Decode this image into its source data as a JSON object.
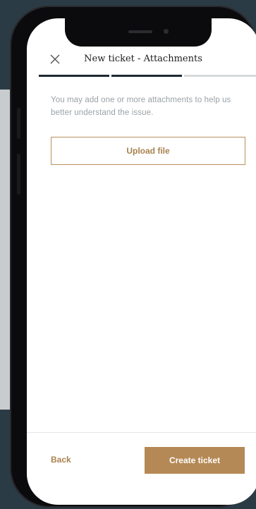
{
  "header": {
    "title": "New ticket - Attachments",
    "close_icon": "close-icon"
  },
  "progress": {
    "steps_total": 3,
    "steps_done": 2,
    "active_color": "#1e2a33",
    "inactive_color": "#d7d9db"
  },
  "main": {
    "description": "You may add one or more attachments to help us better understand the issue.",
    "upload_label": "Upload file"
  },
  "footer": {
    "back_label": "Back",
    "create_label": "Create ticket"
  },
  "colors": {
    "accent": "#b58955",
    "accent_text": "#a9824e",
    "background": "#2b3b45"
  }
}
